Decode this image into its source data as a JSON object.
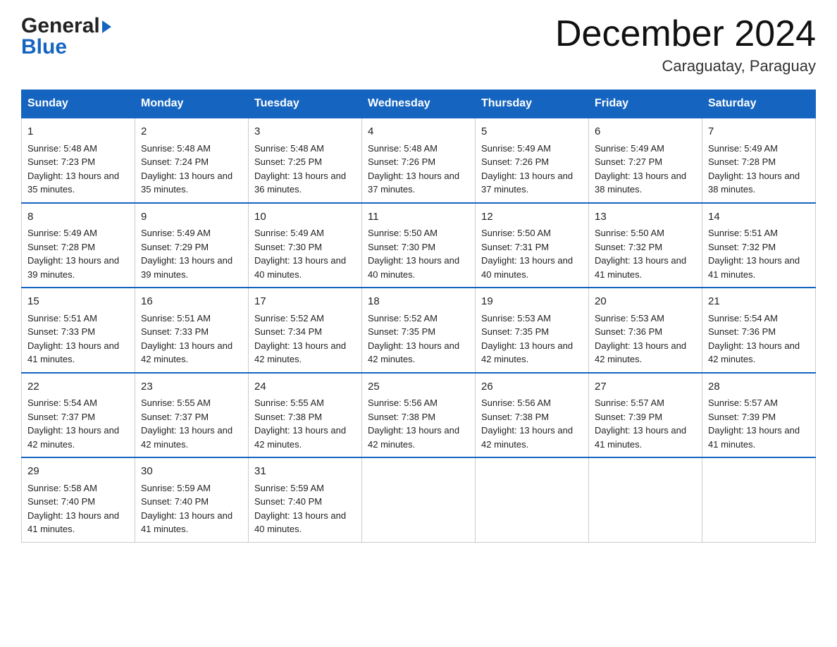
{
  "logo": {
    "general": "General",
    "blue": "Blue"
  },
  "title": {
    "month_year": "December 2024",
    "location": "Caraguatay, Paraguay"
  },
  "headers": [
    "Sunday",
    "Monday",
    "Tuesday",
    "Wednesday",
    "Thursday",
    "Friday",
    "Saturday"
  ],
  "weeks": [
    [
      {
        "day": "1",
        "sunrise": "5:48 AM",
        "sunset": "7:23 PM",
        "daylight": "13 hours and 35 minutes."
      },
      {
        "day": "2",
        "sunrise": "5:48 AM",
        "sunset": "7:24 PM",
        "daylight": "13 hours and 35 minutes."
      },
      {
        "day": "3",
        "sunrise": "5:48 AM",
        "sunset": "7:25 PM",
        "daylight": "13 hours and 36 minutes."
      },
      {
        "day": "4",
        "sunrise": "5:48 AM",
        "sunset": "7:26 PM",
        "daylight": "13 hours and 37 minutes."
      },
      {
        "day": "5",
        "sunrise": "5:49 AM",
        "sunset": "7:26 PM",
        "daylight": "13 hours and 37 minutes."
      },
      {
        "day": "6",
        "sunrise": "5:49 AM",
        "sunset": "7:27 PM",
        "daylight": "13 hours and 38 minutes."
      },
      {
        "day": "7",
        "sunrise": "5:49 AM",
        "sunset": "7:28 PM",
        "daylight": "13 hours and 38 minutes."
      }
    ],
    [
      {
        "day": "8",
        "sunrise": "5:49 AM",
        "sunset": "7:28 PM",
        "daylight": "13 hours and 39 minutes."
      },
      {
        "day": "9",
        "sunrise": "5:49 AM",
        "sunset": "7:29 PM",
        "daylight": "13 hours and 39 minutes."
      },
      {
        "day": "10",
        "sunrise": "5:49 AM",
        "sunset": "7:30 PM",
        "daylight": "13 hours and 40 minutes."
      },
      {
        "day": "11",
        "sunrise": "5:50 AM",
        "sunset": "7:30 PM",
        "daylight": "13 hours and 40 minutes."
      },
      {
        "day": "12",
        "sunrise": "5:50 AM",
        "sunset": "7:31 PM",
        "daylight": "13 hours and 40 minutes."
      },
      {
        "day": "13",
        "sunrise": "5:50 AM",
        "sunset": "7:32 PM",
        "daylight": "13 hours and 41 minutes."
      },
      {
        "day": "14",
        "sunrise": "5:51 AM",
        "sunset": "7:32 PM",
        "daylight": "13 hours and 41 minutes."
      }
    ],
    [
      {
        "day": "15",
        "sunrise": "5:51 AM",
        "sunset": "7:33 PM",
        "daylight": "13 hours and 41 minutes."
      },
      {
        "day": "16",
        "sunrise": "5:51 AM",
        "sunset": "7:33 PM",
        "daylight": "13 hours and 42 minutes."
      },
      {
        "day": "17",
        "sunrise": "5:52 AM",
        "sunset": "7:34 PM",
        "daylight": "13 hours and 42 minutes."
      },
      {
        "day": "18",
        "sunrise": "5:52 AM",
        "sunset": "7:35 PM",
        "daylight": "13 hours and 42 minutes."
      },
      {
        "day": "19",
        "sunrise": "5:53 AM",
        "sunset": "7:35 PM",
        "daylight": "13 hours and 42 minutes."
      },
      {
        "day": "20",
        "sunrise": "5:53 AM",
        "sunset": "7:36 PM",
        "daylight": "13 hours and 42 minutes."
      },
      {
        "day": "21",
        "sunrise": "5:54 AM",
        "sunset": "7:36 PM",
        "daylight": "13 hours and 42 minutes."
      }
    ],
    [
      {
        "day": "22",
        "sunrise": "5:54 AM",
        "sunset": "7:37 PM",
        "daylight": "13 hours and 42 minutes."
      },
      {
        "day": "23",
        "sunrise": "5:55 AM",
        "sunset": "7:37 PM",
        "daylight": "13 hours and 42 minutes."
      },
      {
        "day": "24",
        "sunrise": "5:55 AM",
        "sunset": "7:38 PM",
        "daylight": "13 hours and 42 minutes."
      },
      {
        "day": "25",
        "sunrise": "5:56 AM",
        "sunset": "7:38 PM",
        "daylight": "13 hours and 42 minutes."
      },
      {
        "day": "26",
        "sunrise": "5:56 AM",
        "sunset": "7:38 PM",
        "daylight": "13 hours and 42 minutes."
      },
      {
        "day": "27",
        "sunrise": "5:57 AM",
        "sunset": "7:39 PM",
        "daylight": "13 hours and 41 minutes."
      },
      {
        "day": "28",
        "sunrise": "5:57 AM",
        "sunset": "7:39 PM",
        "daylight": "13 hours and 41 minutes."
      }
    ],
    [
      {
        "day": "29",
        "sunrise": "5:58 AM",
        "sunset": "7:40 PM",
        "daylight": "13 hours and 41 minutes."
      },
      {
        "day": "30",
        "sunrise": "5:59 AM",
        "sunset": "7:40 PM",
        "daylight": "13 hours and 41 minutes."
      },
      {
        "day": "31",
        "sunrise": "5:59 AM",
        "sunset": "7:40 PM",
        "daylight": "13 hours and 40 minutes."
      },
      null,
      null,
      null,
      null
    ]
  ]
}
